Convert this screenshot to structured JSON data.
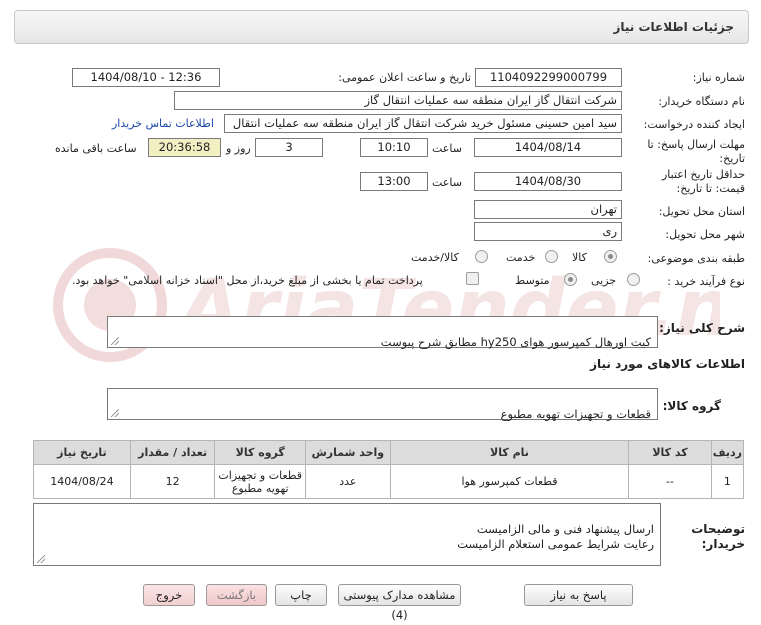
{
  "header": {
    "title": "جزئیات اطلاعات نیاز"
  },
  "fields": {
    "need_number": {
      "label": "شماره نیاز:",
      "value": "1104092299000799"
    },
    "announce_datetime": {
      "label": "تاریخ و ساعت اعلان عمومی:",
      "value": "1404/08/10 - 12:36"
    },
    "buyer_org": {
      "label": "نام دستگاه خریدار:",
      "value": "شرکت انتقال گاز ایران منطقه سه عملیات انتقال گاز"
    },
    "requester": {
      "label": "ایجاد کننده درخواست:",
      "value": "سید امین حسینی مسئول خرید شرکت انتقال گاز ایران منطقه سه عملیات انتقال",
      "contact_link": "اطلاعات تماس خریدار"
    },
    "reply_deadline": {
      "label_line1": "مهلت ارسال پاسخ: تا",
      "label_line2": "تاریخ:",
      "date": "1404/08/14",
      "time_label": "ساعت",
      "time": "10:10",
      "days": "3",
      "days_label": "روز و",
      "remaining": "20:36:58",
      "remaining_label": "ساعت باقی مانده"
    },
    "validity": {
      "label_line1": "حداقل تاریخ اعتبار",
      "label_line2": "قیمت: تا تاریخ:",
      "date": "1404/08/30",
      "time_label": "ساعت",
      "time": "13:00"
    },
    "province": {
      "label": "استان محل تحویل:",
      "value": "تهران"
    },
    "city": {
      "label": "شهر محل تحویل:",
      "value": "ری"
    },
    "category": {
      "label": "طبقه بندی موضوعی:",
      "options": [
        "کالا",
        "خدمت",
        "کالا/خدمت"
      ],
      "selected": 0
    },
    "process_type": {
      "label": "نوع فرآیند خرید :",
      "options": [
        "جزیی",
        "متوسط"
      ],
      "selected": 1,
      "payment_note": "پرداخت تمام یا بخشی از مبلغ خرید،از محل \"اسناد خزانه اسلامی\" خواهد بود."
    }
  },
  "summary": {
    "label": "شرح کلی نیاز:",
    "value": "کیت اورهال کمپرسور هوای hy250 مطابق شرح پیوست"
  },
  "goods_info_title": "اطلاعات کالاهای مورد نیاز",
  "goods_group": {
    "label": "گروه کالا:",
    "value": "قطعات و تجهیزات تهویه مطبوع"
  },
  "table": {
    "headers": [
      "ردیف",
      "کد کالا",
      "نام کالا",
      "واحد شمارش",
      "گروه کالا",
      "تعداد / مقدار",
      "تاریخ نیاز"
    ],
    "rows": [
      [
        "1",
        "--",
        "قطعات کمپرسور هوا",
        "عدد",
        "قطعات و تجهیزات تهویه مطبوع",
        "12",
        "1404/08/24"
      ]
    ]
  },
  "buyer_notes": {
    "label_line1": "توضیحات",
    "label_line2": "خریدار:",
    "value": "ارسال پیشنهاد فنی و مالی الزامیست\nرعایت شرایط عمومی استعلام الزامیست"
  },
  "buttons": {
    "reply": "پاسخ به نیاز",
    "view_docs": "مشاهده مدارک پیوستی (4)",
    "print": "چاپ",
    "back": "بازگشت",
    "exit": "خروج"
  },
  "watermark_text": "AriaTender.neT"
}
